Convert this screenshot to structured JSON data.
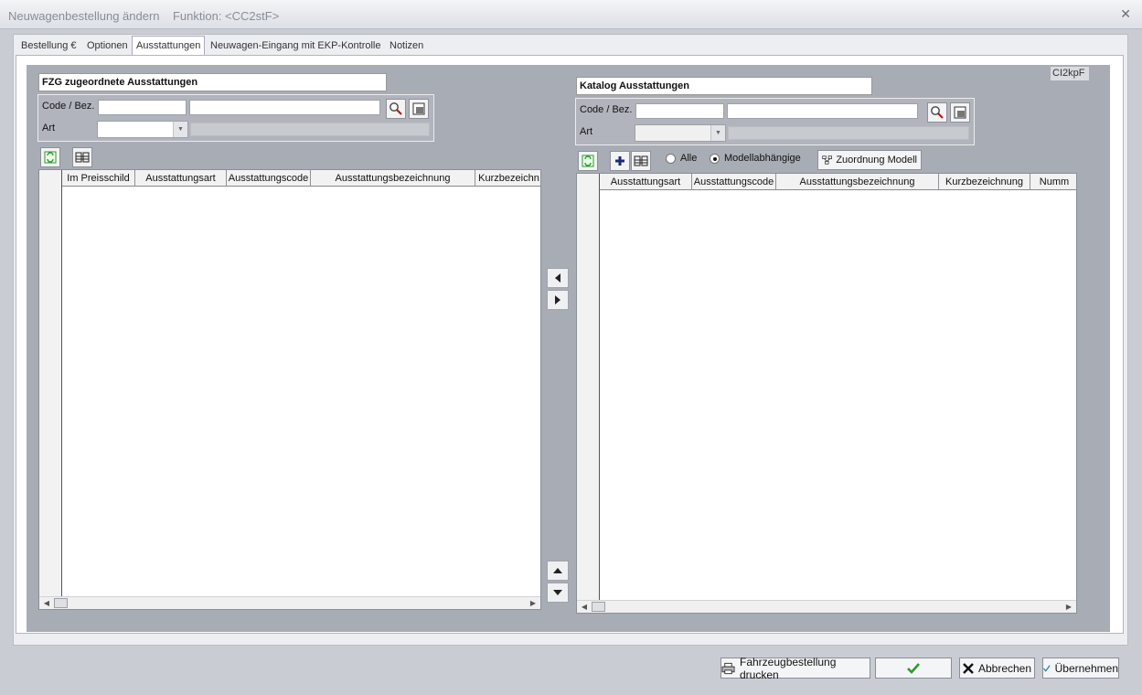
{
  "window": {
    "title": "Neuwagenbestellung ändern",
    "function_label": "Funktion: <CC2stF>"
  },
  "tabs": [
    {
      "label": "Bestellung €"
    },
    {
      "label": "Optionen"
    },
    {
      "label": "Ausstattungen",
      "active": true
    },
    {
      "label": "Neuwagen-Eingang mit EKP-Kontrolle"
    },
    {
      "label": "Notizen"
    }
  ],
  "corner_label": "CI2kpF",
  "left": {
    "header": "FZG zugeordnete Ausstattungen",
    "code_label": "Code / Bez.",
    "art_label": "Art",
    "columns": [
      "Im Preisschild",
      "Ausstattungsart",
      "Ausstattungscode",
      "Ausstattungsbezeichnung",
      "Kurzbezeichn"
    ]
  },
  "right": {
    "header": "Katalog Ausstattungen",
    "code_label": "Code / Bez.",
    "art_label": "Art",
    "radio_all": "Alle",
    "radio_model": "Modellabhängige",
    "assign_button": "Zuordnung Modell",
    "columns": [
      "Ausstattungsart",
      "Ausstattungscode",
      "Ausstattungsbezeichnung",
      "Kurzbezeichnung",
      "Numm"
    ]
  },
  "buttons": {
    "print": "Fahrzeugbestellung drucken",
    "cancel": "Abbrechen",
    "apply": "Übernehmen"
  },
  "colors": {
    "panel": "#a8acb5",
    "accent_green": "#2e9a2e"
  }
}
